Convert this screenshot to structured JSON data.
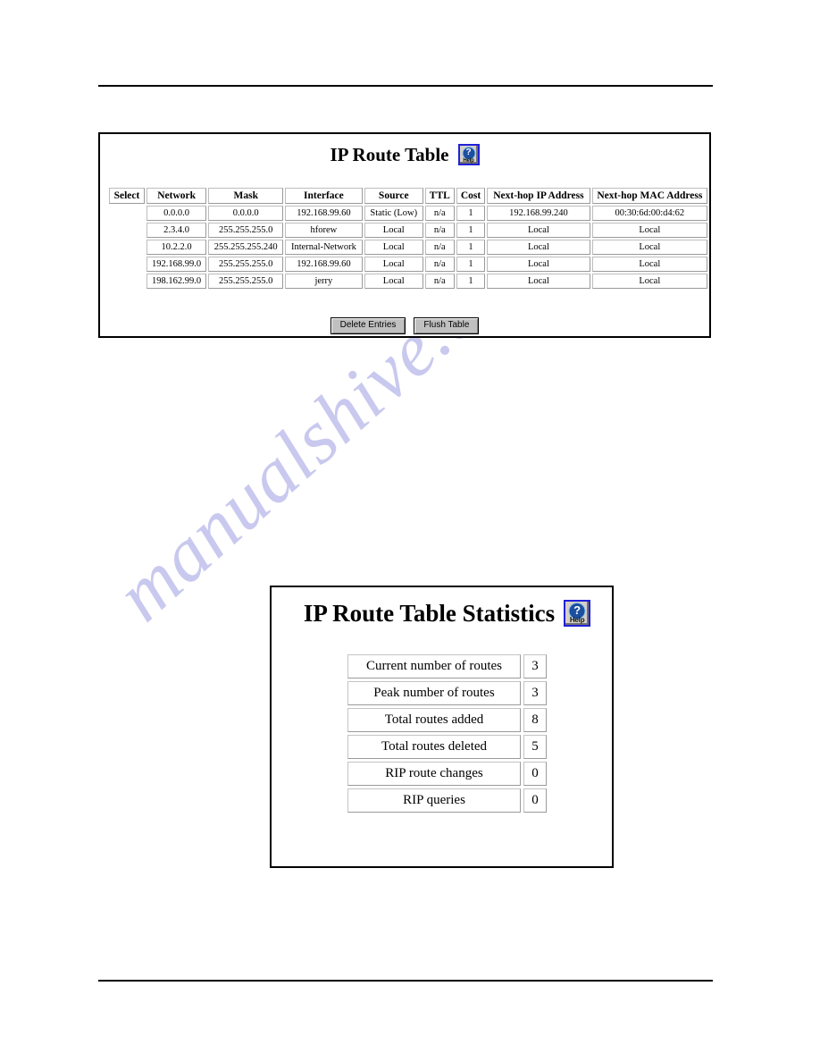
{
  "watermark": {
    "text": "manualshive.com"
  },
  "route_table_panel": {
    "title": "IP Route Table",
    "help_icon": {
      "glyph": "?",
      "label": "Help"
    },
    "columns": [
      "Select",
      "Network",
      "Mask",
      "Interface",
      "Source",
      "TTL",
      "Cost",
      "Next-hop IP Address",
      "Next-hop MAC Address"
    ],
    "rows": [
      {
        "select": "",
        "network": "0.0.0.0",
        "mask": "0.0.0.0",
        "interface": "192.168.99.60",
        "source": "Static (Low)",
        "ttl": "n/a",
        "cost": "1",
        "next_hop_ip": "192.168.99.240",
        "next_hop_mac": "00:30:6d:00:d4:62"
      },
      {
        "select": "",
        "network": "2.3.4.0",
        "mask": "255.255.255.0",
        "interface": "hforew",
        "source": "Local",
        "ttl": "n/a",
        "cost": "1",
        "next_hop_ip": "Local",
        "next_hop_mac": "Local"
      },
      {
        "select": "",
        "network": "10.2.2.0",
        "mask": "255.255.255.240",
        "interface": "Internal-Network",
        "source": "Local",
        "ttl": "n/a",
        "cost": "1",
        "next_hop_ip": "Local",
        "next_hop_mac": "Local"
      },
      {
        "select": "",
        "network": "192.168.99.0",
        "mask": "255.255.255.0",
        "interface": "192.168.99.60",
        "source": "Local",
        "ttl": "n/a",
        "cost": "1",
        "next_hop_ip": "Local",
        "next_hop_mac": "Local"
      },
      {
        "select": "",
        "network": "198.162.99.0",
        "mask": "255.255.255.0",
        "interface": "jerry",
        "source": "Local",
        "ttl": "n/a",
        "cost": "1",
        "next_hop_ip": "Local",
        "next_hop_mac": "Local"
      }
    ],
    "buttons": {
      "delete_entries": "Delete Entries",
      "flush_table": "Flush Table"
    }
  },
  "route_stats_panel": {
    "title": "IP Route Table Statistics",
    "help_icon": {
      "glyph": "?",
      "label": "Help"
    },
    "stats": [
      {
        "label": "Current number of routes",
        "value": "3"
      },
      {
        "label": "Peak number of routes",
        "value": "3"
      },
      {
        "label": "Total routes added",
        "value": "8"
      },
      {
        "label": "Total routes deleted",
        "value": "5"
      },
      {
        "label": "RIP route changes",
        "value": "0"
      },
      {
        "label": "RIP queries",
        "value": "0"
      }
    ]
  },
  "colors": {
    "help_border": "#2020d8",
    "help_face": "#d4d0c8",
    "button_face": "#c0c0c0",
    "watermark": "#c9c9ef",
    "rule": "#000000"
  }
}
